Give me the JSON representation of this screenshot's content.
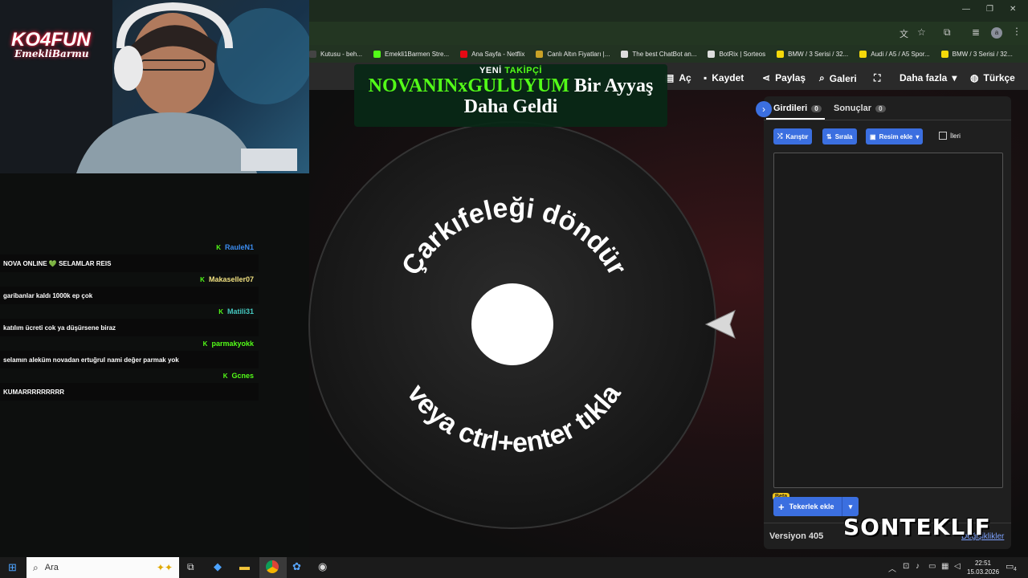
{
  "browser": {
    "bookmarks": [
      {
        "label": "Kutusu - beh...",
        "icon": "generic",
        "color": "#444"
      },
      {
        "label": "Emekli1Barmen Stre...",
        "icon": "kick-icon",
        "color": "#53fc18"
      },
      {
        "label": "Ana Sayfa - Netflix",
        "icon": "netflix-icon",
        "color": "#e50914"
      },
      {
        "label": "Canlı Altın Fiyatları |...",
        "icon": "gold-icon",
        "color": "#c9a227"
      },
      {
        "label": "The best ChatBot an...",
        "icon": "chatbot-icon",
        "color": "#dddddd"
      },
      {
        "label": "BotRix | Sorteos",
        "icon": "botrix-icon",
        "color": "#dddddd"
      },
      {
        "label": "BMW / 3 Serisi / 32...",
        "icon": "s-icon",
        "color": "#f5d90a"
      },
      {
        "label": "Audi / A5 / A5 Spor...",
        "icon": "s-icon",
        "color": "#f5d90a"
      },
      {
        "label": "BMW / 3 Serisi / 32...",
        "icon": "s-icon",
        "color": "#f5d90a"
      }
    ],
    "profile_initial": "a"
  },
  "menu": {
    "open": "Aç",
    "save": "Kaydet",
    "share": "Paylaş",
    "gallery": "Galeri",
    "more": "Daha fazla",
    "language": "Türkçe"
  },
  "overlay": {
    "logo_line1": "KO4FUN",
    "logo_line2": "EmekliBarmu",
    "alert_header_prefix": "YENİ",
    "alert_header_accent": "TAKİPÇİ",
    "alert_name": "NOVANINxGULUYUM",
    "alert_text1": "Bir Ayyaş",
    "alert_text2": "Daha Geldi",
    "watermark": "SONTEKLIF"
  },
  "chat": [
    {
      "user": "RauleN1",
      "user_color": "#3b8cf0",
      "message": "NOVA ONLINE 💚 SELAMLAR REIS"
    },
    {
      "user": "Makaseller07",
      "user_color": "#f0e080",
      "message": "garibanlar kaldı 1000k ep çok"
    },
    {
      "user": "Matili31",
      "user_color": "#45c9c0",
      "message": "katılım ücreti cok ya düşürsene biraz"
    },
    {
      "user": "parmakyokk",
      "user_color": "#53fc18",
      "message": "selamın aleküm novadan ertuğrul nami değer parmak yok"
    },
    {
      "user": "Gcnes",
      "user_color": "#53fc18",
      "message": "KUMARRRRRRRRR"
    }
  ],
  "wheel": {
    "top_text": "Çarkıfeleği döndür",
    "bottom_text": "veya ctrl+enter tıkla"
  },
  "panel": {
    "tab_entries": "Girdileri",
    "tab_entries_count": "0",
    "tab_results": "Sonuçlar",
    "tab_results_count": "0",
    "shuffle": "Karıştır",
    "sort": "Sırala",
    "add_image": "Resim ekle",
    "advanced": "İleri",
    "beta": "Beta",
    "add_wheels": "Tekerlek ekle",
    "version": "Versiyon 405",
    "changes": "Değişiklikler"
  },
  "taskbar": {
    "search_placeholder": "Ara",
    "time": "22:51",
    "date": "15.03.2026",
    "notification_count": "4"
  },
  "colors": {
    "accent_blue": "#3b6fe0",
    "kick_green": "#53fc18",
    "chrome_bg": "#223322"
  }
}
